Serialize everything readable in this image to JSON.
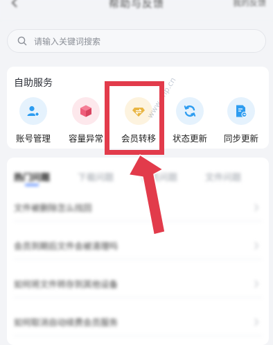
{
  "header": {
    "title": "帮助与反馈",
    "action": "我的反馈"
  },
  "search": {
    "placeholder": "请输入关键词搜索"
  },
  "self_service": {
    "title": "自助服务",
    "items": [
      {
        "label": "账号管理",
        "icon": "user-gear-icon",
        "bg": "#e5f2fd",
        "color": "#2d9cf0"
      },
      {
        "label": "容量异常",
        "icon": "cube-icon",
        "bg": "#fde8ec",
        "color": "#ef5d7a"
      },
      {
        "label": "会员转移",
        "icon": "diamond-transfer-icon",
        "bg": "#fdf3df",
        "color": "#e9b542"
      },
      {
        "label": "状态更新",
        "icon": "refresh-icon",
        "bg": "#e5f2fd",
        "color": "#2d9cf0"
      },
      {
        "label": "同步更新",
        "icon": "document-sync-icon",
        "bg": "#e5f2fd",
        "color": "#2d9cf0"
      }
    ]
  },
  "faq": {
    "tabs": [
      "热门问题",
      "下载问题",
      "会员问题",
      "文件问题"
    ],
    "questions": [
      "文件被删除怎么找回",
      "会员到期后文件会被清理吗",
      "如何将文件转存到其他设备",
      "如何取消自动续费会员服务"
    ]
  },
  "annotation": {
    "color": "#e23b4b"
  }
}
